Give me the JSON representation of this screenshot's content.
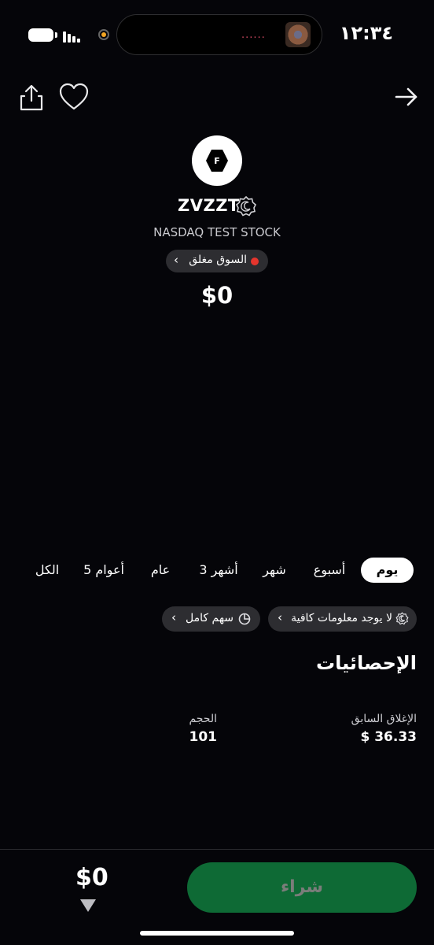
{
  "status_bar": {
    "time": "١٢:٣٤",
    "island_dots": "......"
  },
  "stock": {
    "logo_letter": "F",
    "ticker": "ZVZZT",
    "company": "NASDAQ TEST STOCK",
    "market_status": "السوق مغلق",
    "price": "$0"
  },
  "periods": [
    "يوم",
    "أسبوع",
    "شهر",
    "3 أشهر",
    "عام",
    "5 أعوام",
    "الكل"
  ],
  "selected_period": "يوم",
  "chips": {
    "info": "لا يوجد معلومات كافية",
    "share_type": "سهم كامل"
  },
  "stats": {
    "title": "الإحصائيات",
    "prev_close_label": "الإغلاق السابق",
    "prev_close_value": "$ 36.33",
    "volume_label": "الحجم",
    "volume_value": "101"
  },
  "bottom_bar": {
    "buy_label": "شراء",
    "price": "$0"
  },
  "colors": {
    "background": "#050509",
    "buy_button": "#0e6a35",
    "market_closed_dot": "#e5352d",
    "chip_bg": "#2d2d31"
  }
}
